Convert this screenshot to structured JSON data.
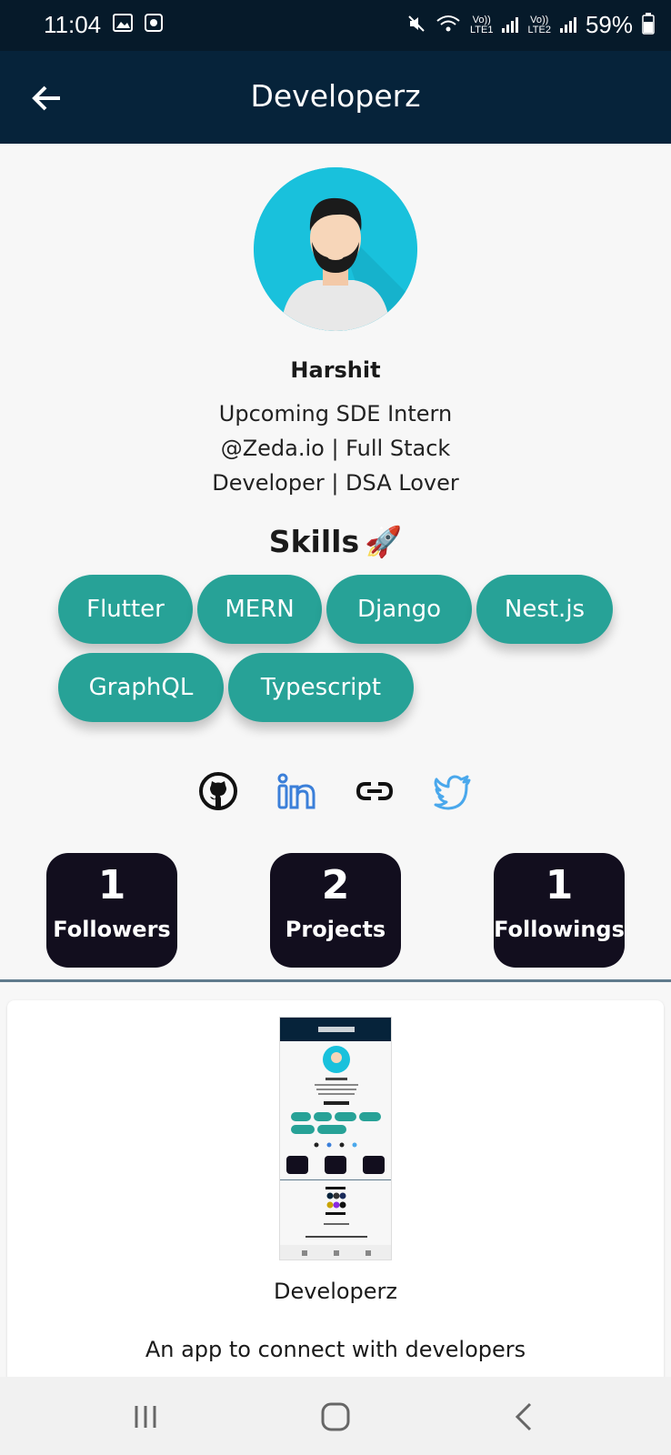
{
  "status_bar": {
    "time": "11:04",
    "battery": "59%",
    "net1_top": "Vo))",
    "net1_bottom": "LTE1",
    "net2_top": "Vo))",
    "net2_bottom": "LTE2",
    "icons": [
      "image-icon",
      "screen-record-icon",
      "mute-icon",
      "wifi-icon",
      "signal-icon",
      "battery-icon"
    ]
  },
  "app_bar": {
    "title": "Developerz",
    "back_icon": "arrow-left-icon"
  },
  "profile": {
    "name": "Harshit",
    "bio_lines": [
      "Upcoming SDE Intern",
      "@Zeda.io | Full Stack",
      "Developer | DSA Lover"
    ],
    "skills_title": "Skills",
    "skills_emoji": "🚀",
    "skills": [
      "Flutter",
      "MERN",
      "Django",
      "Nest.js",
      "GraphQL",
      "Typescript"
    ],
    "links": [
      "github-icon",
      "linkedin-icon",
      "link-icon",
      "twitter-icon"
    ]
  },
  "stats": [
    {
      "value": "1",
      "label": "Followers"
    },
    {
      "value": "2",
      "label": "Projects"
    },
    {
      "value": "1",
      "label": "Followings"
    }
  ],
  "project": {
    "title": "Developerz",
    "description": "An app to connect with developers"
  },
  "colors": {
    "app_bar": "#06233a",
    "status_bar": "#061a2a",
    "chip": "#27a297",
    "stat_card": "#120e1e",
    "linkedin": "#3b7fd9",
    "twitter": "#4aa8ec"
  }
}
